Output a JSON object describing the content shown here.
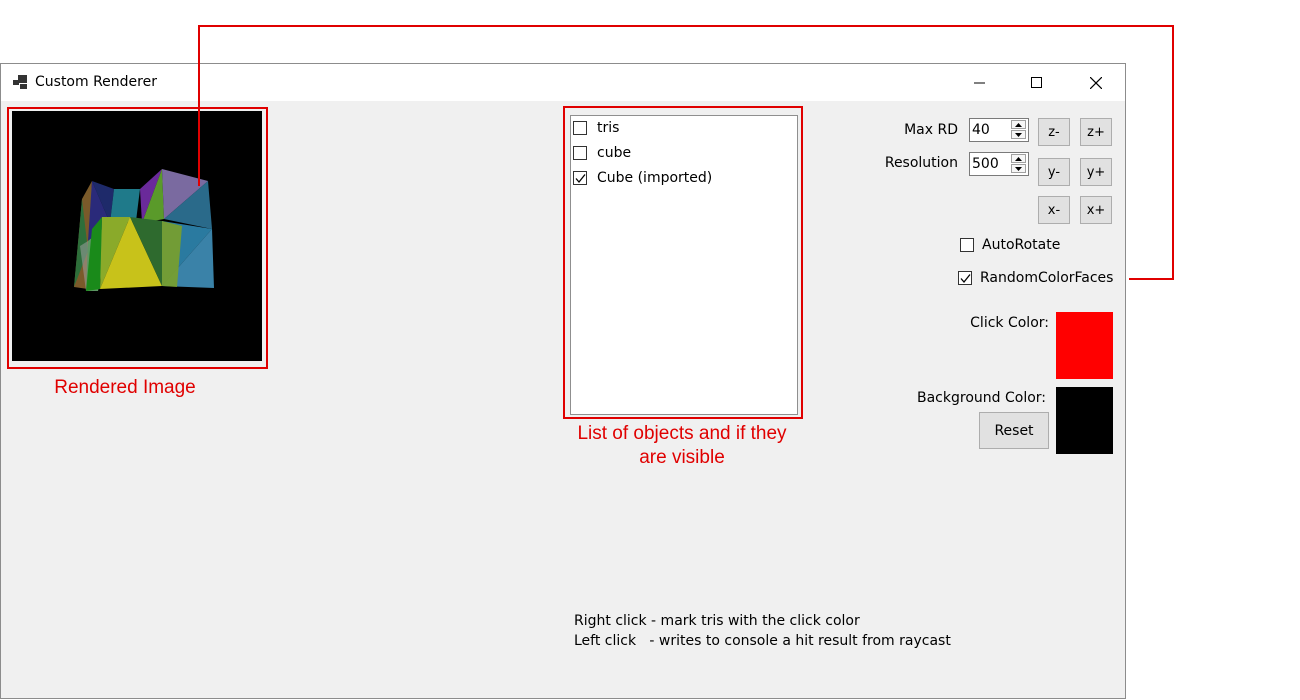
{
  "window": {
    "title": "Custom Renderer",
    "icon": "app-windows-icon"
  },
  "objects": {
    "items": [
      {
        "label": "tris",
        "checked": false
      },
      {
        "label": "cube",
        "checked": false
      },
      {
        "label": "Cube (imported)",
        "checked": true
      }
    ]
  },
  "controls": {
    "max_rd_label": "Max RD",
    "max_rd_value": "40",
    "resolution_label": "Resolution",
    "resolution_value": "500",
    "z_minus": "z-",
    "z_plus": "z+",
    "y_minus": "y-",
    "y_plus": "y+",
    "x_minus": "x-",
    "x_plus": "x+",
    "autorotate_label": "AutoRotate",
    "autorotate_checked": false,
    "random_color_faces_label": "RandomColorFaces",
    "random_color_faces_checked": true,
    "click_color_label": "Click Color:",
    "click_color": "#ff0000",
    "background_color_label": "Background Color:",
    "background_color": "#000000",
    "reset_label": "Reset"
  },
  "hints": {
    "right_click": "Right click - mark tris with the click color",
    "left_click": "Left click   - writes to console a hit result from raycast"
  },
  "annotations": {
    "rendered_image": "Rendered Image",
    "object_list_line1": "List of objects and if they",
    "object_list_line2": "are visible",
    "accent_color": "#e00000"
  }
}
